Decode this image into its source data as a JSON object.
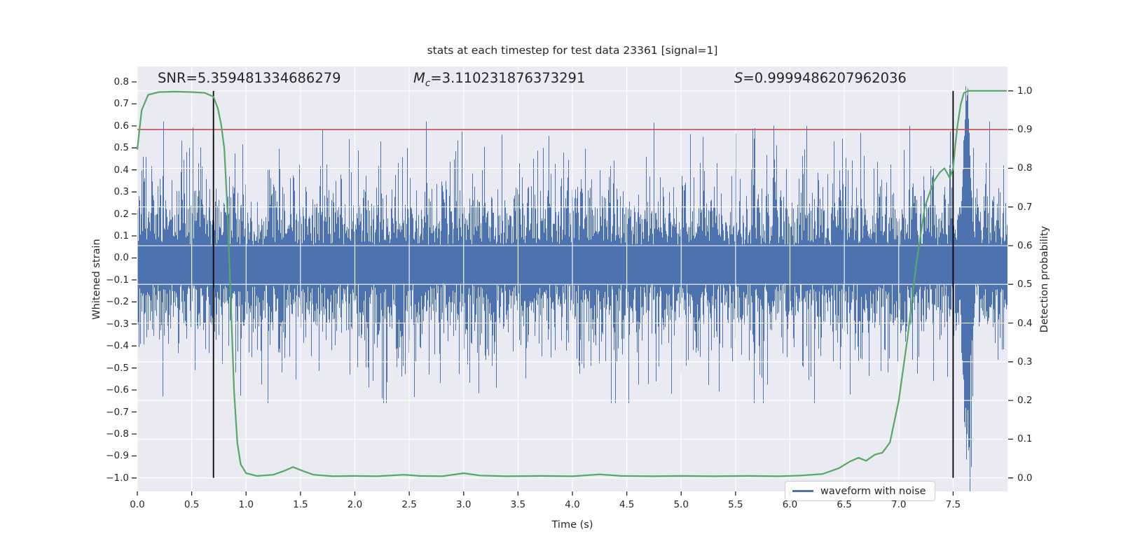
{
  "figure": {
    "title": "stats at each timestep for test data 23361 [signal=1]",
    "background": "#ffffff",
    "plot_background": "#eaeaf2",
    "grid_color": "#ffffff",
    "text_color": "#262626"
  },
  "annotations": [
    {
      "main": "SNR",
      "sub": "",
      "value": "=5.359481334686279"
    },
    {
      "main": "M",
      "sub": "c",
      "value": "=3.110231876373291"
    },
    {
      "main": "S",
      "sub": "",
      "value": "=0.9999486207962036"
    }
  ],
  "axes": {
    "x": {
      "label": "Time (s)",
      "min": 0.0,
      "max": 8.0,
      "tick_labels": [
        "0.0",
        "0.5",
        "1.0",
        "1.5",
        "2.0",
        "2.5",
        "3.0",
        "3.5",
        "4.0",
        "4.5",
        "5.0",
        "5.5",
        "6.0",
        "6.5",
        "7.0",
        "7.5"
      ],
      "tick_values": [
        0.0,
        0.5,
        1.0,
        1.5,
        2.0,
        2.5,
        3.0,
        3.5,
        4.0,
        4.5,
        5.0,
        5.5,
        6.0,
        6.5,
        7.0,
        7.5
      ]
    },
    "y_left": {
      "label": "Whitened strain",
      "top": 0.87,
      "bottom": -1.061,
      "tick_labels": [
        "0.8",
        "0.7",
        "0.6",
        "0.5",
        "0.4",
        "0.3",
        "0.2",
        "0.1",
        "0.0",
        "−0.1",
        "−0.2",
        "−0.3",
        "−0.4",
        "−0.5",
        "−0.6",
        "−0.7",
        "−0.8",
        "−0.9",
        "−1.0"
      ],
      "tick_values": [
        0.8,
        0.7,
        0.6,
        0.5,
        0.4,
        0.3,
        0.2,
        0.1,
        0.0,
        -0.1,
        -0.2,
        -0.3,
        -0.4,
        -0.5,
        -0.6,
        -0.7,
        -0.8,
        -0.9,
        -1.0
      ]
    },
    "y_right": {
      "label": "Detection probability",
      "top": 1.063,
      "bottom": -0.035,
      "tick_labels": [
        "1.0",
        "0.9",
        "0.8",
        "0.7",
        "0.6",
        "0.5",
        "0.4",
        "0.3",
        "0.2",
        "0.1",
        "0.0"
      ],
      "tick_values": [
        1.0,
        0.9,
        0.8,
        0.7,
        0.6,
        0.5,
        0.4,
        0.3,
        0.2,
        0.1,
        0.0
      ]
    }
  },
  "chart_data": {
    "type": "line",
    "title": "stats at each timestep for test data 23361 [signal=1]",
    "xlabel": "Time (s)",
    "ylabel_left": "Whitened strain",
    "ylabel_right": "Detection probability",
    "x_range": [
      0.0,
      8.0
    ],
    "grid": true,
    "series": [
      {
        "name": "waveform with noise",
        "axis": "left",
        "color": "#4c72b0",
        "kind": "noise-band",
        "seed": 20361,
        "base_upper": 0.06,
        "base_lower": 0.115,
        "sigma": 0.16,
        "tail_prob": 0.07,
        "tail_extra": 0.34,
        "clip_upper": 0.62,
        "clip_lower": 0.66,
        "burst": {
          "t_start": 7.54,
          "t_end": 7.73,
          "center": 7.625,
          "width": 0.048,
          "max_upper": 0.77,
          "max_lower": 1.0
        },
        "feature_spikes": [
          {
            "t": 0.05,
            "side": "up",
            "value": 0.46
          },
          {
            "t": 0.23,
            "side": "down",
            "value": 0.63
          },
          {
            "t": 0.9,
            "side": "down",
            "value": 0.52
          },
          {
            "t": 1.33,
            "side": "down",
            "value": 0.52
          },
          {
            "t": 1.7,
            "side": "up",
            "value": 0.585
          },
          {
            "t": 1.95,
            "side": "down",
            "value": 0.53
          },
          {
            "t": 2.98,
            "side": "up",
            "value": 0.575
          },
          {
            "t": 3.35,
            "side": "up",
            "value": 0.56
          },
          {
            "t": 4.1,
            "side": "down",
            "value": 0.5
          },
          {
            "t": 4.75,
            "side": "up",
            "value": 0.615
          },
          {
            "t": 5.0,
            "side": "down",
            "value": 0.52
          },
          {
            "t": 5.2,
            "side": "up",
            "value": 0.55
          },
          {
            "t": 6.15,
            "side": "up",
            "value": 0.6
          },
          {
            "t": 6.55,
            "side": "down",
            "value": 0.62
          },
          {
            "t": 6.9,
            "side": "down",
            "value": 0.52
          },
          {
            "t": 7.1,
            "side": "up",
            "value": 0.6
          },
          {
            "t": 7.47,
            "side": "up",
            "value": 0.575
          },
          {
            "t": 7.615,
            "side": "up",
            "value": 0.78
          },
          {
            "t": 7.63,
            "side": "up",
            "value": 0.77
          },
          {
            "t": 7.645,
            "side": "down",
            "value": 0.86
          },
          {
            "t": 7.655,
            "side": "down",
            "value": 1.06
          },
          {
            "t": 7.665,
            "side": "down",
            "value": 0.95
          },
          {
            "t": 7.68,
            "side": "down",
            "value": 0.63
          }
        ]
      },
      {
        "name": "detection probability",
        "axis": "right",
        "color": "#55a868",
        "kind": "line",
        "points": [
          [
            0.0,
            0.85
          ],
          [
            0.04,
            0.95
          ],
          [
            0.1,
            0.99
          ],
          [
            0.2,
            0.997
          ],
          [
            0.35,
            0.998
          ],
          [
            0.5,
            0.997
          ],
          [
            0.62,
            0.995
          ],
          [
            0.7,
            0.985
          ],
          [
            0.74,
            0.955
          ],
          [
            0.77,
            0.915
          ],
          [
            0.8,
            0.85
          ],
          [
            0.83,
            0.68
          ],
          [
            0.86,
            0.45
          ],
          [
            0.89,
            0.22
          ],
          [
            0.92,
            0.09
          ],
          [
            0.95,
            0.035
          ],
          [
            1.0,
            0.012
          ],
          [
            1.1,
            0.005
          ],
          [
            1.25,
            0.008
          ],
          [
            1.35,
            0.018
          ],
          [
            1.43,
            0.028
          ],
          [
            1.52,
            0.018
          ],
          [
            1.62,
            0.008
          ],
          [
            1.8,
            0.004
          ],
          [
            2.0,
            0.005
          ],
          [
            2.2,
            0.004
          ],
          [
            2.45,
            0.008
          ],
          [
            2.6,
            0.005
          ],
          [
            2.8,
            0.004
          ],
          [
            3.0,
            0.012
          ],
          [
            3.15,
            0.006
          ],
          [
            3.4,
            0.004
          ],
          [
            3.7,
            0.005
          ],
          [
            4.0,
            0.004
          ],
          [
            4.25,
            0.009
          ],
          [
            4.45,
            0.005
          ],
          [
            4.75,
            0.004
          ],
          [
            5.0,
            0.005
          ],
          [
            5.3,
            0.004
          ],
          [
            5.6,
            0.005
          ],
          [
            5.9,
            0.004
          ],
          [
            6.1,
            0.006
          ],
          [
            6.3,
            0.01
          ],
          [
            6.45,
            0.025
          ],
          [
            6.55,
            0.042
          ],
          [
            6.63,
            0.052
          ],
          [
            6.7,
            0.044
          ],
          [
            6.78,
            0.06
          ],
          [
            6.85,
            0.065
          ],
          [
            6.92,
            0.092
          ],
          [
            7.0,
            0.2
          ],
          [
            7.08,
            0.36
          ],
          [
            7.16,
            0.55
          ],
          [
            7.24,
            0.7
          ],
          [
            7.32,
            0.765
          ],
          [
            7.38,
            0.79
          ],
          [
            7.42,
            0.8
          ],
          [
            7.47,
            0.775
          ],
          [
            7.5,
            0.8
          ],
          [
            7.52,
            0.86
          ],
          [
            7.54,
            0.91
          ],
          [
            7.57,
            0.965
          ],
          [
            7.6,
            0.995
          ],
          [
            7.64,
            1.0
          ],
          [
            7.8,
            1.0
          ],
          [
            7.99,
            1.0
          ]
        ]
      }
    ],
    "threshold_line": {
      "axis": "right",
      "value": 0.9,
      "color": "#c44e52"
    },
    "event_marker_lines": {
      "x_values": [
        0.7,
        7.5
      ],
      "color": "#000000",
      "span_probability": [
        0.0,
        1.0
      ]
    },
    "legend": {
      "label": "waveform with noise",
      "position": "lower right",
      "line_color": "#4c72b0"
    }
  }
}
